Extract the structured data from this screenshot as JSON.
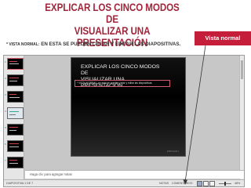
{
  "heading": {
    "line1": "EXPLICAR LOS CINCO MODOS DE",
    "line2": "VISUALIZAR UNA PRESENTACIÓN"
  },
  "badge": "Vista normal",
  "subtitle": {
    "prefix": "* VISTA NORMAL:",
    "text": "EN ESTA SE PUEDEN CREAR Y EDITAR LAS DIAPOSITIVAS."
  },
  "slide": {
    "title_line1": "EXPLICAR LOS CINCO MODOS DE",
    "title_line2": "VISUALIZAR UNA PRESENTACIÓN",
    "bullet": "* VISTA NORMAL: en esta se pueden crear y editar las diapositivas.",
    "footer": "EXPLICAR 1"
  },
  "thumbnails": [
    "1",
    "2",
    "3",
    "4",
    "5",
    "6",
    "7"
  ],
  "notes_placeholder": "Haga clic para agregar notas",
  "status": {
    "slide_info": "DIAPOSITIVA 1 DE 7",
    "notes": "NOTAS",
    "comments": "COMENTARIOS",
    "zoom": "48%"
  },
  "colors": {
    "accent": "#c41e3a",
    "title": "#a0263b"
  }
}
